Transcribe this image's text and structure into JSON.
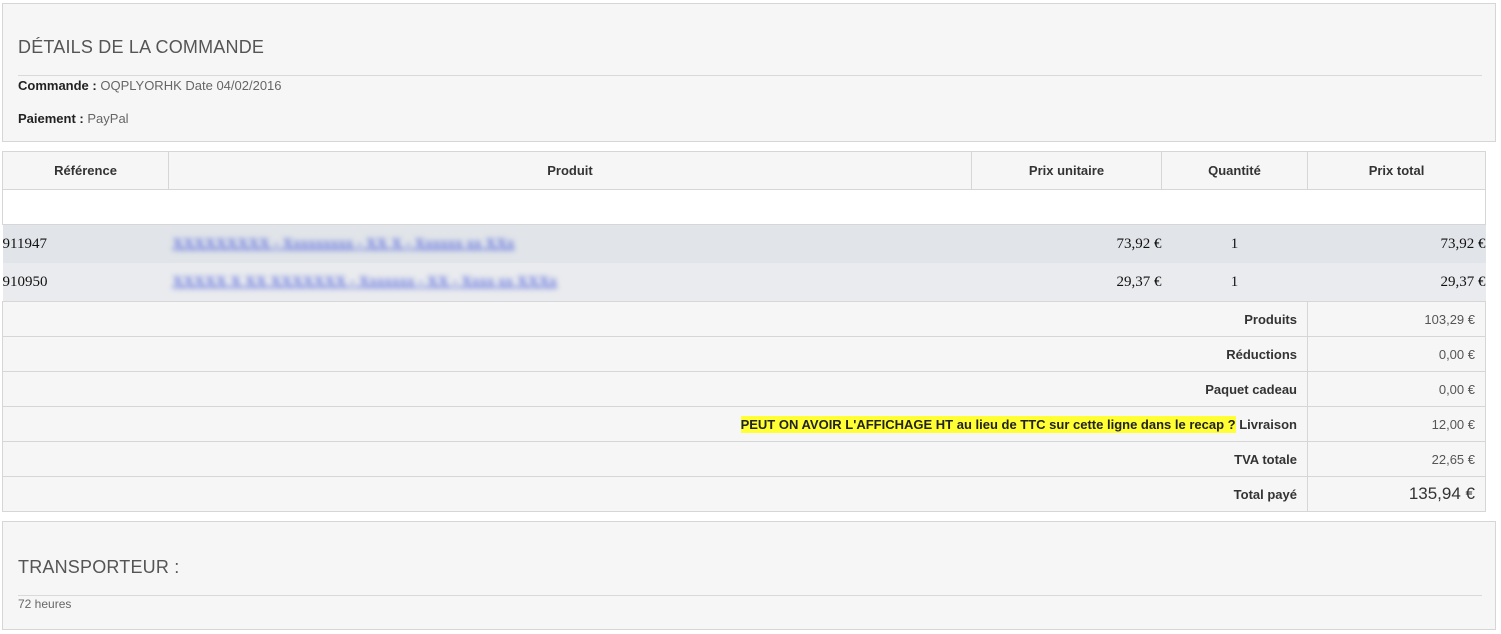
{
  "order_details": {
    "title": "DÉTAILS DE LA COMMANDE",
    "order_label": "Commande :",
    "order_ref": "OQPLYORHK",
    "date_text": "Date 04/02/2016",
    "payment_label": "Paiement :",
    "payment_method": "PayPal"
  },
  "table": {
    "headers": [
      "Référence",
      "Produit",
      "Prix unitaire",
      "Quantité",
      "Prix total"
    ],
    "items": [
      {
        "reference": "911947",
        "product": "XXXXXXXXX - Xxxxxxxxx - XX X - Xxxxxx xx XXx",
        "unit_price": "73,92 €",
        "quantity": "1",
        "total_price": "73,92 €"
      },
      {
        "reference": "910950",
        "product": "XXXXX X XX XXXXXXX - Xxxxxxx - XX - Xxxx xx XXXx",
        "unit_price": "29,37 €",
        "quantity": "1",
        "total_price": "29,37 €"
      }
    ]
  },
  "summary": {
    "products_label": "Produits",
    "products_value": "103,29 €",
    "discounts_label": "Réductions",
    "discounts_value": "0,00 €",
    "gift_label": "Paquet cadeau",
    "gift_value": "0,00 €",
    "shipping_note": "PEUT ON AVOIR L'AFFICHAGE HT au lieu de TTC sur cette ligne dans le recap ?",
    "shipping_label": "Livraison",
    "shipping_value": "12,00 €",
    "vat_label": "TVA totale",
    "vat_value": "22,65 €",
    "total_label": "Total payé",
    "total_value": "135,94 €"
  },
  "carrier": {
    "title": "TRANSPORTEUR :",
    "delay": "72 heures"
  },
  "colors": {
    "highlight": "#ffff33",
    "link": "#2a3fd9",
    "row_bg": "#e1e5e9"
  }
}
